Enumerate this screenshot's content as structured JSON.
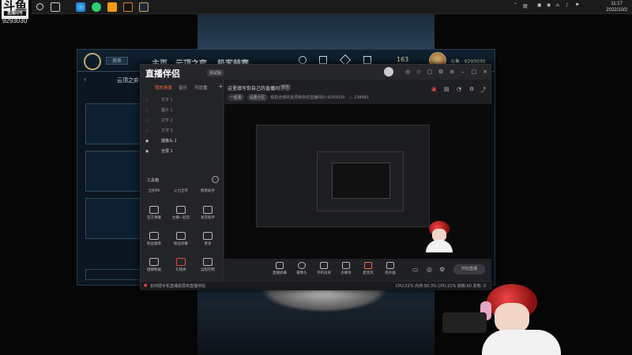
{
  "overlay": {
    "logo": "斗鱼",
    "logo_sub": "直播间号",
    "room_id": "9293030"
  },
  "taskbar": {
    "input_method": "联",
    "clock_time": "11:17",
    "clock_date": "2022/10/2"
  },
  "game": {
    "search_label": "搜索",
    "nav": [
      "主页",
      "云顶之弈",
      "极客赫赛"
    ],
    "coins": "163",
    "username": "斗鱼 · 9293030",
    "sub_tab": "云顶之弈 · 合作"
  },
  "app": {
    "title": "直播伴侣",
    "badge": "测试版",
    "tabs": [
      "我的场景",
      "音乐",
      "可设置"
    ],
    "scenes": [
      "文字 1",
      "图片 1",
      "文字 2",
      "文字 3",
      "摄像头 1",
      "全屏 1"
    ],
    "tools_title": "工具箱",
    "tools": [
      "全民PK",
      "火力全开",
      "情景助手",
      "官方弹幕",
      "主播一起玩",
      "发货助手",
      "粉丝徽章",
      "粉丝闭幕",
      "更多",
      "健康数据",
      "礼物秀",
      "远程控制"
    ],
    "stream_title": "这里填写你自己的直播间标题",
    "title_tag": "修改",
    "info_chips": [
      "一起看",
      "设置分区"
    ],
    "info_text": "观看全部的选项和你的直播间ID:9293030",
    "viewer_count": "238481",
    "bottom_items": [
      "直播屏幕",
      "摄像头",
      "手机投屏",
      "多媒体",
      "麦克风",
      "扬声器"
    ],
    "go_live": "开始直播",
    "status_left": "如何把手机直播投屏到直播伴侣",
    "status_right": "CPU:21%  内存:50.3%  CPU:21%  帧数:60  本地: 0"
  }
}
